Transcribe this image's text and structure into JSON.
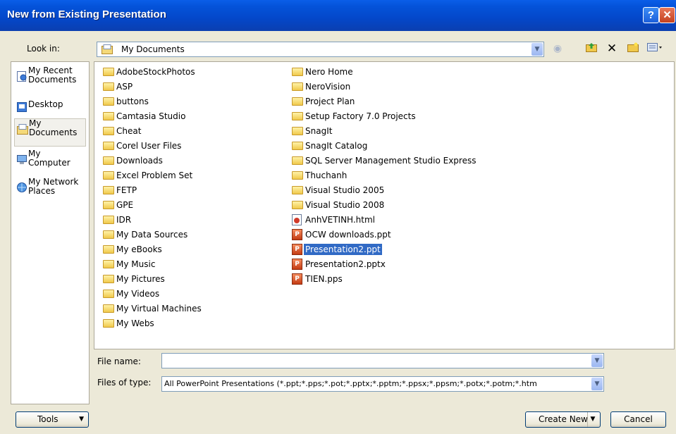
{
  "window": {
    "title": "New from Existing Presentation",
    "help_label": "?",
    "close_label": "✕"
  },
  "lookin": {
    "label": "Look in:",
    "value": "My Documents"
  },
  "toolbar_icons": [
    "back-icon",
    "up-folder-icon",
    "delete-icon",
    "new-folder-icon",
    "views-icon"
  ],
  "places": [
    {
      "label": "My Recent Documents",
      "icon": "recent-documents-icon"
    },
    {
      "label": "Desktop",
      "icon": "desktop-icon"
    },
    {
      "label": "My Documents",
      "icon": "my-documents-icon",
      "selected": true
    },
    {
      "label": "My Computer",
      "icon": "computer-icon"
    },
    {
      "label": "My Network Places",
      "icon": "network-places-icon"
    }
  ],
  "files_col1": [
    {
      "name": "AdobeStockPhotos",
      "type": "folder"
    },
    {
      "name": "ASP",
      "type": "folder"
    },
    {
      "name": "buttons",
      "type": "folder"
    },
    {
      "name": "Camtasia Studio",
      "type": "folder"
    },
    {
      "name": "Cheat",
      "type": "folder"
    },
    {
      "name": "Corel User Files",
      "type": "folder"
    },
    {
      "name": "Downloads",
      "type": "folder"
    },
    {
      "name": "Excel Problem Set",
      "type": "folder"
    },
    {
      "name": "FETP",
      "type": "folder"
    },
    {
      "name": "GPE",
      "type": "folder"
    },
    {
      "name": "IDR",
      "type": "folder"
    },
    {
      "name": "My Data Sources",
      "type": "folder"
    },
    {
      "name": "My eBooks",
      "type": "folder"
    },
    {
      "name": "My Music",
      "type": "folder"
    },
    {
      "name": "My Pictures",
      "type": "folder"
    },
    {
      "name": "My Videos",
      "type": "folder"
    },
    {
      "name": "My Virtual Machines",
      "type": "folder"
    },
    {
      "name": "My Webs",
      "type": "folder"
    }
  ],
  "files_col2": [
    {
      "name": "Nero Home",
      "type": "folder"
    },
    {
      "name": "NeroVision",
      "type": "folder"
    },
    {
      "name": "Project Plan",
      "type": "folder"
    },
    {
      "name": "Setup Factory 7.0 Projects",
      "type": "folder"
    },
    {
      "name": "SnagIt",
      "type": "folder"
    },
    {
      "name": "SnagIt Catalog",
      "type": "folder"
    },
    {
      "name": "SQL Server Management Studio Express",
      "type": "folder"
    },
    {
      "name": "Thuchanh",
      "type": "folder"
    },
    {
      "name": "Visual Studio 2005",
      "type": "folder"
    },
    {
      "name": "Visual Studio 2008",
      "type": "folder"
    },
    {
      "name": "AnhVETINH.html",
      "type": "html"
    },
    {
      "name": "OCW downloads.ppt",
      "type": "ppt"
    },
    {
      "name": "Presentation2.ppt",
      "type": "ppt",
      "selected": true
    },
    {
      "name": "Presentation2.pptx",
      "type": "pptx"
    },
    {
      "name": "TIEN.pps",
      "type": "pps"
    }
  ],
  "filename": {
    "label": "File name:",
    "value": ""
  },
  "filetype": {
    "label": "Files of type:",
    "value": "All PowerPoint Presentations (*.ppt;*.pps;*.pot;*.pptx;*.pptm;*.ppsx;*.ppsm;*.potx;*.potm;*.htm"
  },
  "buttons": {
    "tools": "Tools",
    "create_new": "Create New",
    "cancel": "Cancel"
  }
}
